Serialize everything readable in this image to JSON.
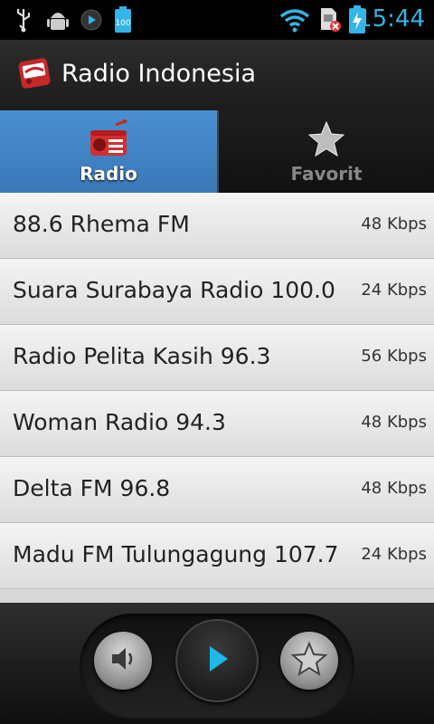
{
  "status_bar": {
    "time": "15:44",
    "battery_badge": "100",
    "icons": [
      "usb-icon",
      "android-debug-icon",
      "media-play-icon",
      "battery-100-icon",
      "wifi-icon",
      "sim-error-icon",
      "battery-charging-icon"
    ],
    "accent_color": "#33b5e5"
  },
  "action_bar": {
    "title": "Radio Indonesia",
    "app_icon": "radio-app-icon"
  },
  "tabs": [
    {
      "label": "Radio",
      "icon": "radio-icon",
      "selected": true
    },
    {
      "label": "Favorit",
      "icon": "star-icon",
      "selected": false
    }
  ],
  "stations": [
    {
      "name": "88.6 Rhema FM",
      "bitrate": "48 Kbps"
    },
    {
      "name": "Suara Surabaya Radio 100.0",
      "bitrate": "24 Kbps"
    },
    {
      "name": "Radio Pelita Kasih 96.3",
      "bitrate": "56 Kbps"
    },
    {
      "name": "Woman Radio 94.3",
      "bitrate": "48 Kbps"
    },
    {
      "name": "Delta FM 96.8",
      "bitrate": "48 Kbps"
    },
    {
      "name": "Madu FM Tulungagung 107.7",
      "bitrate": "24 Kbps"
    }
  ],
  "player": {
    "buttons": [
      "volume-icon",
      "play-icon",
      "favorite-star-icon"
    ]
  },
  "colors": {
    "tab_selected": "#3a78b8",
    "play_accent": "#1eb8e8"
  }
}
